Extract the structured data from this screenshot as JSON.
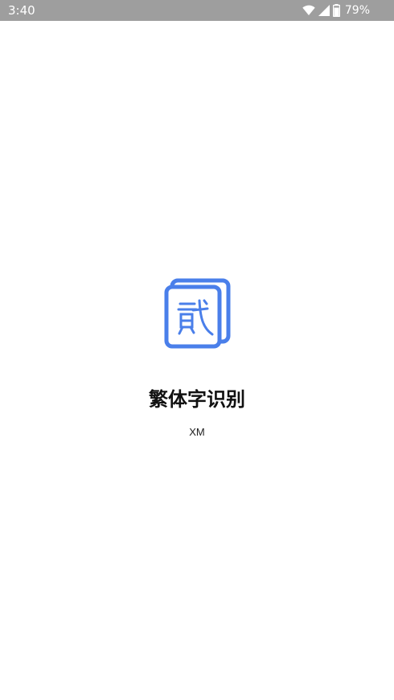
{
  "status_bar": {
    "time": "3:40",
    "battery_percent": "79%",
    "icons": [
      "wifi-icon",
      "signal-icon",
      "battery-icon"
    ],
    "background_color": "#9e9e9e"
  },
  "splash": {
    "logo_icon": "document-stack-character-icon",
    "logo_color": "#4a7fea",
    "app_name": "繁体字识别",
    "author": "XM"
  }
}
